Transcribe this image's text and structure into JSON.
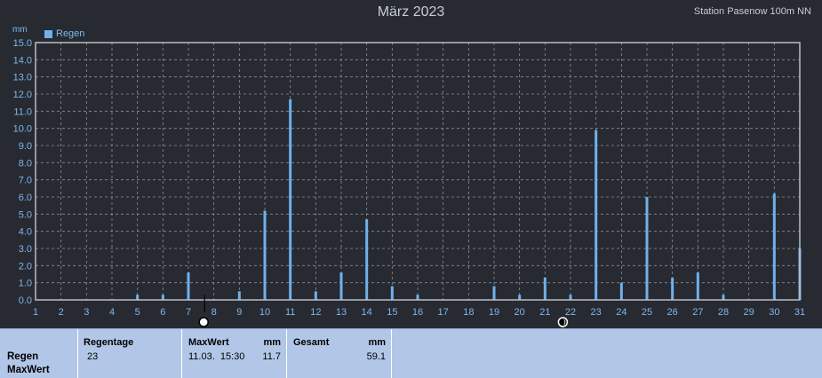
{
  "header": {
    "title": "März 2023",
    "station": "Station Pasenow 100m NN",
    "unit": "mm",
    "legend": "Regen"
  },
  "colors": {
    "background": "#272a31",
    "grid": "#8a8e96",
    "axis": "#b9bdc5",
    "bar": "#6fb1ec",
    "tick_text": "#7fb6ee",
    "summary_bg": "#b2c7e8"
  },
  "chart_data": {
    "type": "bar",
    "title": "März 2023",
    "ylabel": "mm",
    "ylim": [
      0,
      15
    ],
    "xlim": [
      1,
      31
    ],
    "yticks": [
      "0.0",
      "1.0",
      "2.0",
      "3.0",
      "4.0",
      "5.0",
      "6.0",
      "7.0",
      "8.0",
      "9.0",
      "10.0",
      "11.0",
      "12.0",
      "13.0",
      "14.0",
      "15.0"
    ],
    "xticks": [
      "1",
      "2",
      "3",
      "4",
      "5",
      "6",
      "7",
      "8",
      "9",
      "10",
      "11",
      "12",
      "13",
      "14",
      "15",
      "16",
      "17",
      "18",
      "19",
      "20",
      "21",
      "22",
      "23",
      "24",
      "25",
      "26",
      "27",
      "28",
      "29",
      "30",
      "31"
    ],
    "grid": true,
    "legend_position": "top-left",
    "series": [
      {
        "name": "Regen",
        "points": [
          {
            "x": 5,
            "y": 0.3
          },
          {
            "x": 6,
            "y": 0.3
          },
          {
            "x": 7,
            "y": 1.6
          },
          {
            "x": 9,
            "y": 0.5
          },
          {
            "x": 10,
            "y": 5.2
          },
          {
            "x": 11,
            "y": 11.7
          },
          {
            "x": 12,
            "y": 0.5
          },
          {
            "x": 13,
            "y": 1.6
          },
          {
            "x": 14,
            "y": 4.7
          },
          {
            "x": 15,
            "y": 0.8
          },
          {
            "x": 16,
            "y": 0.3
          },
          {
            "x": 19,
            "y": 0.8
          },
          {
            "x": 20,
            "y": 0.3
          },
          {
            "x": 21,
            "y": 1.3
          },
          {
            "x": 22,
            "y": 0.3
          },
          {
            "x": 23,
            "y": 9.9
          },
          {
            "x": 24,
            "y": 1.0
          },
          {
            "x": 25,
            "y": 6.0
          },
          {
            "x": 26,
            "y": 1.3
          },
          {
            "x": 27,
            "y": 1.6
          },
          {
            "x": 28,
            "y": 0.3
          },
          {
            "x": 30,
            "y": 6.2
          },
          {
            "x": 31,
            "y": 3.0
          }
        ]
      }
    ],
    "moon_phases": [
      {
        "x": 7.6,
        "phase": "full"
      },
      {
        "x": 21.7,
        "phase": "new"
      }
    ]
  },
  "summary": {
    "row_label_1": "Regen",
    "row_label_2": "MaxWert",
    "regentage_header": "Regentage",
    "regentage_value": "23",
    "maxwert_header": "MaxWert",
    "maxwert_unit": "mm",
    "maxwert_time": "11.03.  15:30",
    "maxwert_value": "11.7",
    "gesamt_header": "Gesamt",
    "gesamt_unit": "mm",
    "gesamt_value": "59.1"
  }
}
